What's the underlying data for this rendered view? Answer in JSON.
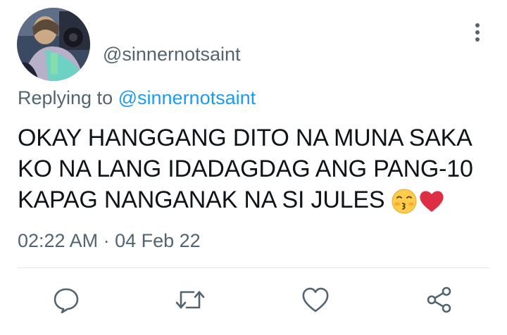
{
  "tweet": {
    "handle": "@sinnernotsaint",
    "replying_prefix": "Replying to",
    "replying_to": "@sinnernotsaint",
    "text_lines": [
      "OKAY HANGGANG DITO NA MUNA SAKA",
      "KO NA LANG IDADAGDAG ANG PANG-10",
      "KAPAG NANGANAK NA SI JULES"
    ],
    "emojis": [
      "kissing-face-emoji",
      "red-heart-emoji"
    ],
    "time": "02:22 AM",
    "separator": "·",
    "date": "04 Feb 22"
  },
  "actions": [
    "reply-icon",
    "retweet-icon",
    "like-icon",
    "share-icon"
  ],
  "colors": {
    "text": "#0f1419",
    "secondary": "#536471",
    "link": "#1d9bf0",
    "heart": "#e0245e"
  }
}
